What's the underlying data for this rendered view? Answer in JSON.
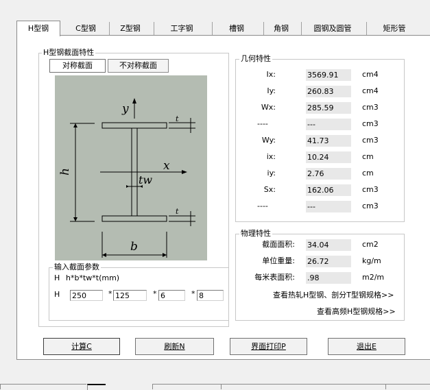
{
  "tabs": [
    {
      "label": "H型钢",
      "active": true
    },
    {
      "label": "C型钢"
    },
    {
      "label": "Z型钢"
    },
    {
      "label": "工字钢"
    },
    {
      "label": "槽钢"
    },
    {
      "label": "角钢"
    },
    {
      "label": "圆钢及圆管"
    },
    {
      "label": "矩形管"
    }
  ],
  "section_group": {
    "title": "H型钢截面特性",
    "symmetric_label": "对称截面",
    "asymmetric_label": "不对称截面"
  },
  "diagram": {
    "bg_color": "#b4bcb2",
    "labels": {
      "y": "y",
      "x": "x",
      "h": "h",
      "b": "b",
      "tw": "tw",
      "t_top": "t",
      "t_bottom": "t"
    }
  },
  "input_group": {
    "title": "输入截面参数",
    "type": "H",
    "formula": "h*b*tw*t(mm)",
    "row_label": "H",
    "h_value": "250",
    "b_value": "125",
    "tw_value": "6",
    "t_value": "8",
    "mult": "*"
  },
  "geometry": {
    "title": "几何特性",
    "rows": [
      {
        "label": "Ix:",
        "value": "3569.91",
        "unit": "cm4"
      },
      {
        "label": "Iy:",
        "value": "260.83",
        "unit": "cm4"
      },
      {
        "label": "Wx:",
        "value": "285.59",
        "unit": "cm3"
      },
      {
        "label": "----",
        "value": "---",
        "unit": "cm3"
      },
      {
        "label": "Wy:",
        "value": "41.73",
        "unit": "cm3"
      },
      {
        "label": "ix:",
        "value": "10.24",
        "unit": "cm"
      },
      {
        "label": "iy:",
        "value": "2.76",
        "unit": "cm"
      },
      {
        "label": "Sx:",
        "value": "162.06",
        "unit": "cm3"
      },
      {
        "label": "----",
        "value": "---",
        "unit": "cm3"
      }
    ]
  },
  "physical": {
    "title": "物理特性",
    "rows": [
      {
        "label": "截面面积:",
        "value": "34.04",
        "unit": "cm2"
      },
      {
        "label": "单位重量:",
        "value": "26.72",
        "unit": "kg/m"
      },
      {
        "label": "每米表面积:",
        "value": ".98",
        "unit": "m2/m"
      }
    ],
    "link1": "查看热轧H型钢、剖分T型钢规格>>",
    "link2": "查看高频H型钢规格>>"
  },
  "bottom": {
    "calc": "计算C",
    "refresh": "刷新N",
    "print": "界面打印P",
    "exit": "退出E"
  }
}
